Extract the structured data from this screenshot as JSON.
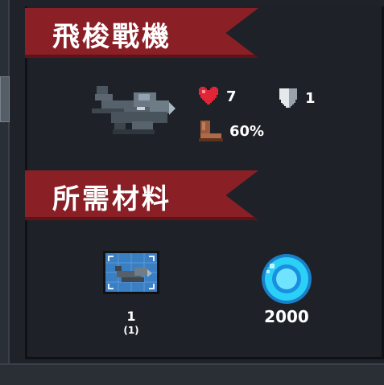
{
  "section_unit": {
    "title": "飛梭戰機"
  },
  "stats": {
    "hp": {
      "icon": "heart-icon",
      "value": "7"
    },
    "armor": {
      "icon": "shield-icon",
      "value": "1"
    },
    "speed": {
      "icon": "boot-icon",
      "value": "60%"
    }
  },
  "section_materials": {
    "title": "所需材料"
  },
  "materials": [
    {
      "icon": "blueprint-fighter-icon",
      "amount": "1",
      "owned": "(1)"
    },
    {
      "icon": "blue-gem-coin-icon",
      "amount": "2000"
    }
  ],
  "colors": {
    "ribbon": "#8a1f26",
    "panel": "#1e2228",
    "gem": "#2ad0f5"
  }
}
